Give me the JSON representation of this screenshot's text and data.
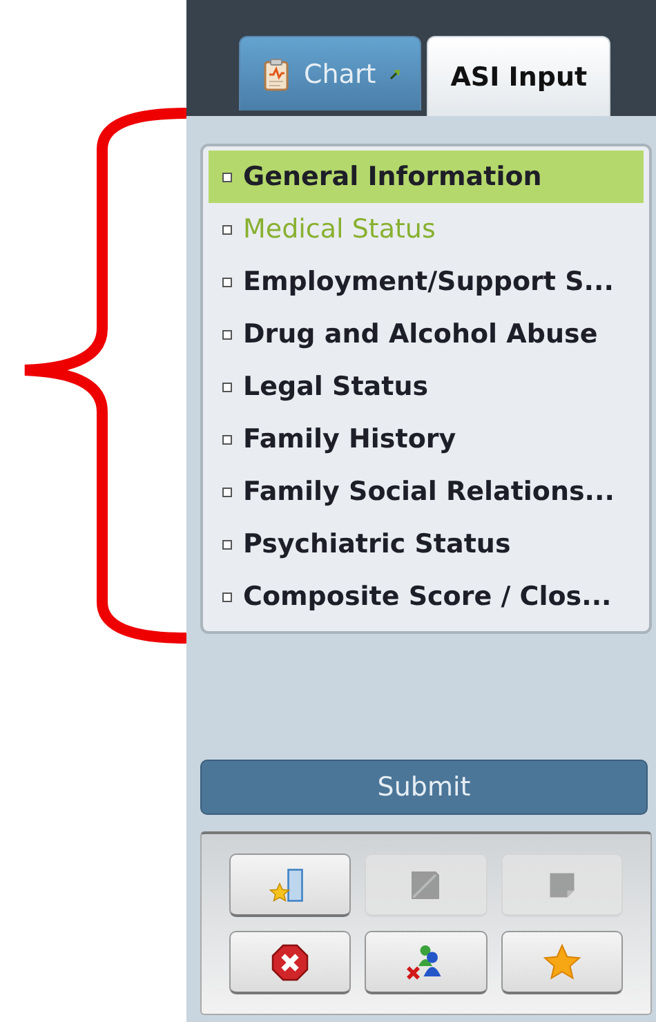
{
  "tabs": [
    {
      "label": "Chart",
      "selected": false,
      "external": true
    },
    {
      "label": "ASI Input",
      "selected": true,
      "external": false
    }
  ],
  "sections": [
    {
      "label": "General Information",
      "selected": true,
      "visited": false
    },
    {
      "label": "Medical Status",
      "selected": false,
      "visited": true
    },
    {
      "label": "Employment/Support S...",
      "selected": false,
      "visited": false
    },
    {
      "label": "Drug and Alcohol Abuse",
      "selected": false,
      "visited": false
    },
    {
      "label": "Legal Status",
      "selected": false,
      "visited": false
    },
    {
      "label": "Family History",
      "selected": false,
      "visited": false
    },
    {
      "label": "Family Social Relations...",
      "selected": false,
      "visited": false
    },
    {
      "label": "Psychiatric Status",
      "selected": false,
      "visited": false
    },
    {
      "label": "Composite Score / Clos...",
      "selected": false,
      "visited": false
    }
  ],
  "submit": {
    "label": "Submit"
  },
  "tools": [
    {
      "kind": "open",
      "disabled": false
    },
    {
      "kind": "edit",
      "disabled": true
    },
    {
      "kind": "note",
      "disabled": true
    },
    {
      "kind": "cancel",
      "disabled": false
    },
    {
      "kind": "remove-user",
      "disabled": false
    },
    {
      "kind": "favorite",
      "disabled": false
    }
  ]
}
